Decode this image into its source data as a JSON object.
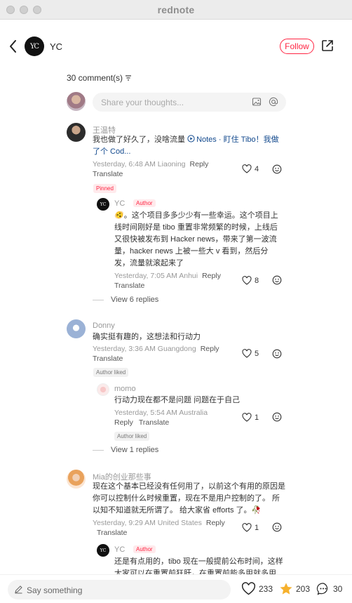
{
  "window": {
    "title": "rednote"
  },
  "header": {
    "author": "YC",
    "avatar_text": "YC",
    "follow_label": "Follow"
  },
  "comments_section": {
    "count_label": "30 comment(s)",
    "input_placeholder": "Share your thoughts..."
  },
  "comments": [
    {
      "name": "王温特",
      "body_line1_pre": "我也做了好久了，没啥流量 ",
      "link_text": "Notes · 盯住 Tibo！我做",
      "body_line2": "了个 Cod...",
      "meta": "Yesterday, 6:48 AM Liaoning",
      "reply_label": "Reply",
      "translate_label": "Translate",
      "likes": "4",
      "pinned_label": "Pinned",
      "reply": {
        "name": "YC",
        "author_tag": "Author",
        "body_lines": [
          "🫨。这个项目多多少少有一些幸运。这个项目上",
          "线时间刚好是 tibo 重置非常频繁的时候，上线后",
          "又很快被发布到 Hacker news，带来了第一波流",
          "量，hacker news 上被一些大 v 看到，然后分",
          "发，流量就滚起来了"
        ],
        "meta": "Yesterday, 7:05 AM Anhui",
        "reply_label": "Reply",
        "translate_label": "Translate",
        "likes": "8"
      },
      "view_replies": "View 6 replies"
    },
    {
      "name": "Donny",
      "body": "确实挺有趣的，这想法和行动力",
      "meta": "Yesterday, 3:36 AM Guangdong",
      "reply_label": "Reply",
      "translate_label": "Translate",
      "likes": "5",
      "author_liked": "Author liked",
      "reply": {
        "name": "momo",
        "body": "行动力现在都不是问题 问题在于自己",
        "meta": "Yesterday, 5:54 AM Australia",
        "reply_label": "Reply",
        "translate_label": "Translate",
        "likes": "1",
        "author_liked": "Author liked"
      },
      "view_replies": "View 1 replies"
    },
    {
      "name": "Mia的创业那些事",
      "body_lines": [
        "现在这个基本已经没有任何用了，以前这个有用的原因是",
        "你可以控制什么时候重置，现在不是用户控制的了。 所",
        "以知不知道就无所谓了。 给大家省 efforts 了。🥀"
      ],
      "meta": "Yesterday, 9:29 AM United States",
      "reply_label": "Reply",
      "translate_label": "Translate",
      "likes": "1",
      "reply": {
        "name": "YC",
        "author_tag": "Author",
        "body_lines": [
          "还是有点用的，tibo 现在一般提前公布时间，这样",
          "大家可以在重置前狂肝，在重置前能多用就多用"
        ]
      }
    }
  ],
  "bottom_bar": {
    "input_placeholder": "Say something",
    "likes": "233",
    "collects": "203",
    "comments": "30"
  },
  "colors": {
    "accent": "#ff2442",
    "link": "#134a8e",
    "star": "#f6b12d"
  }
}
